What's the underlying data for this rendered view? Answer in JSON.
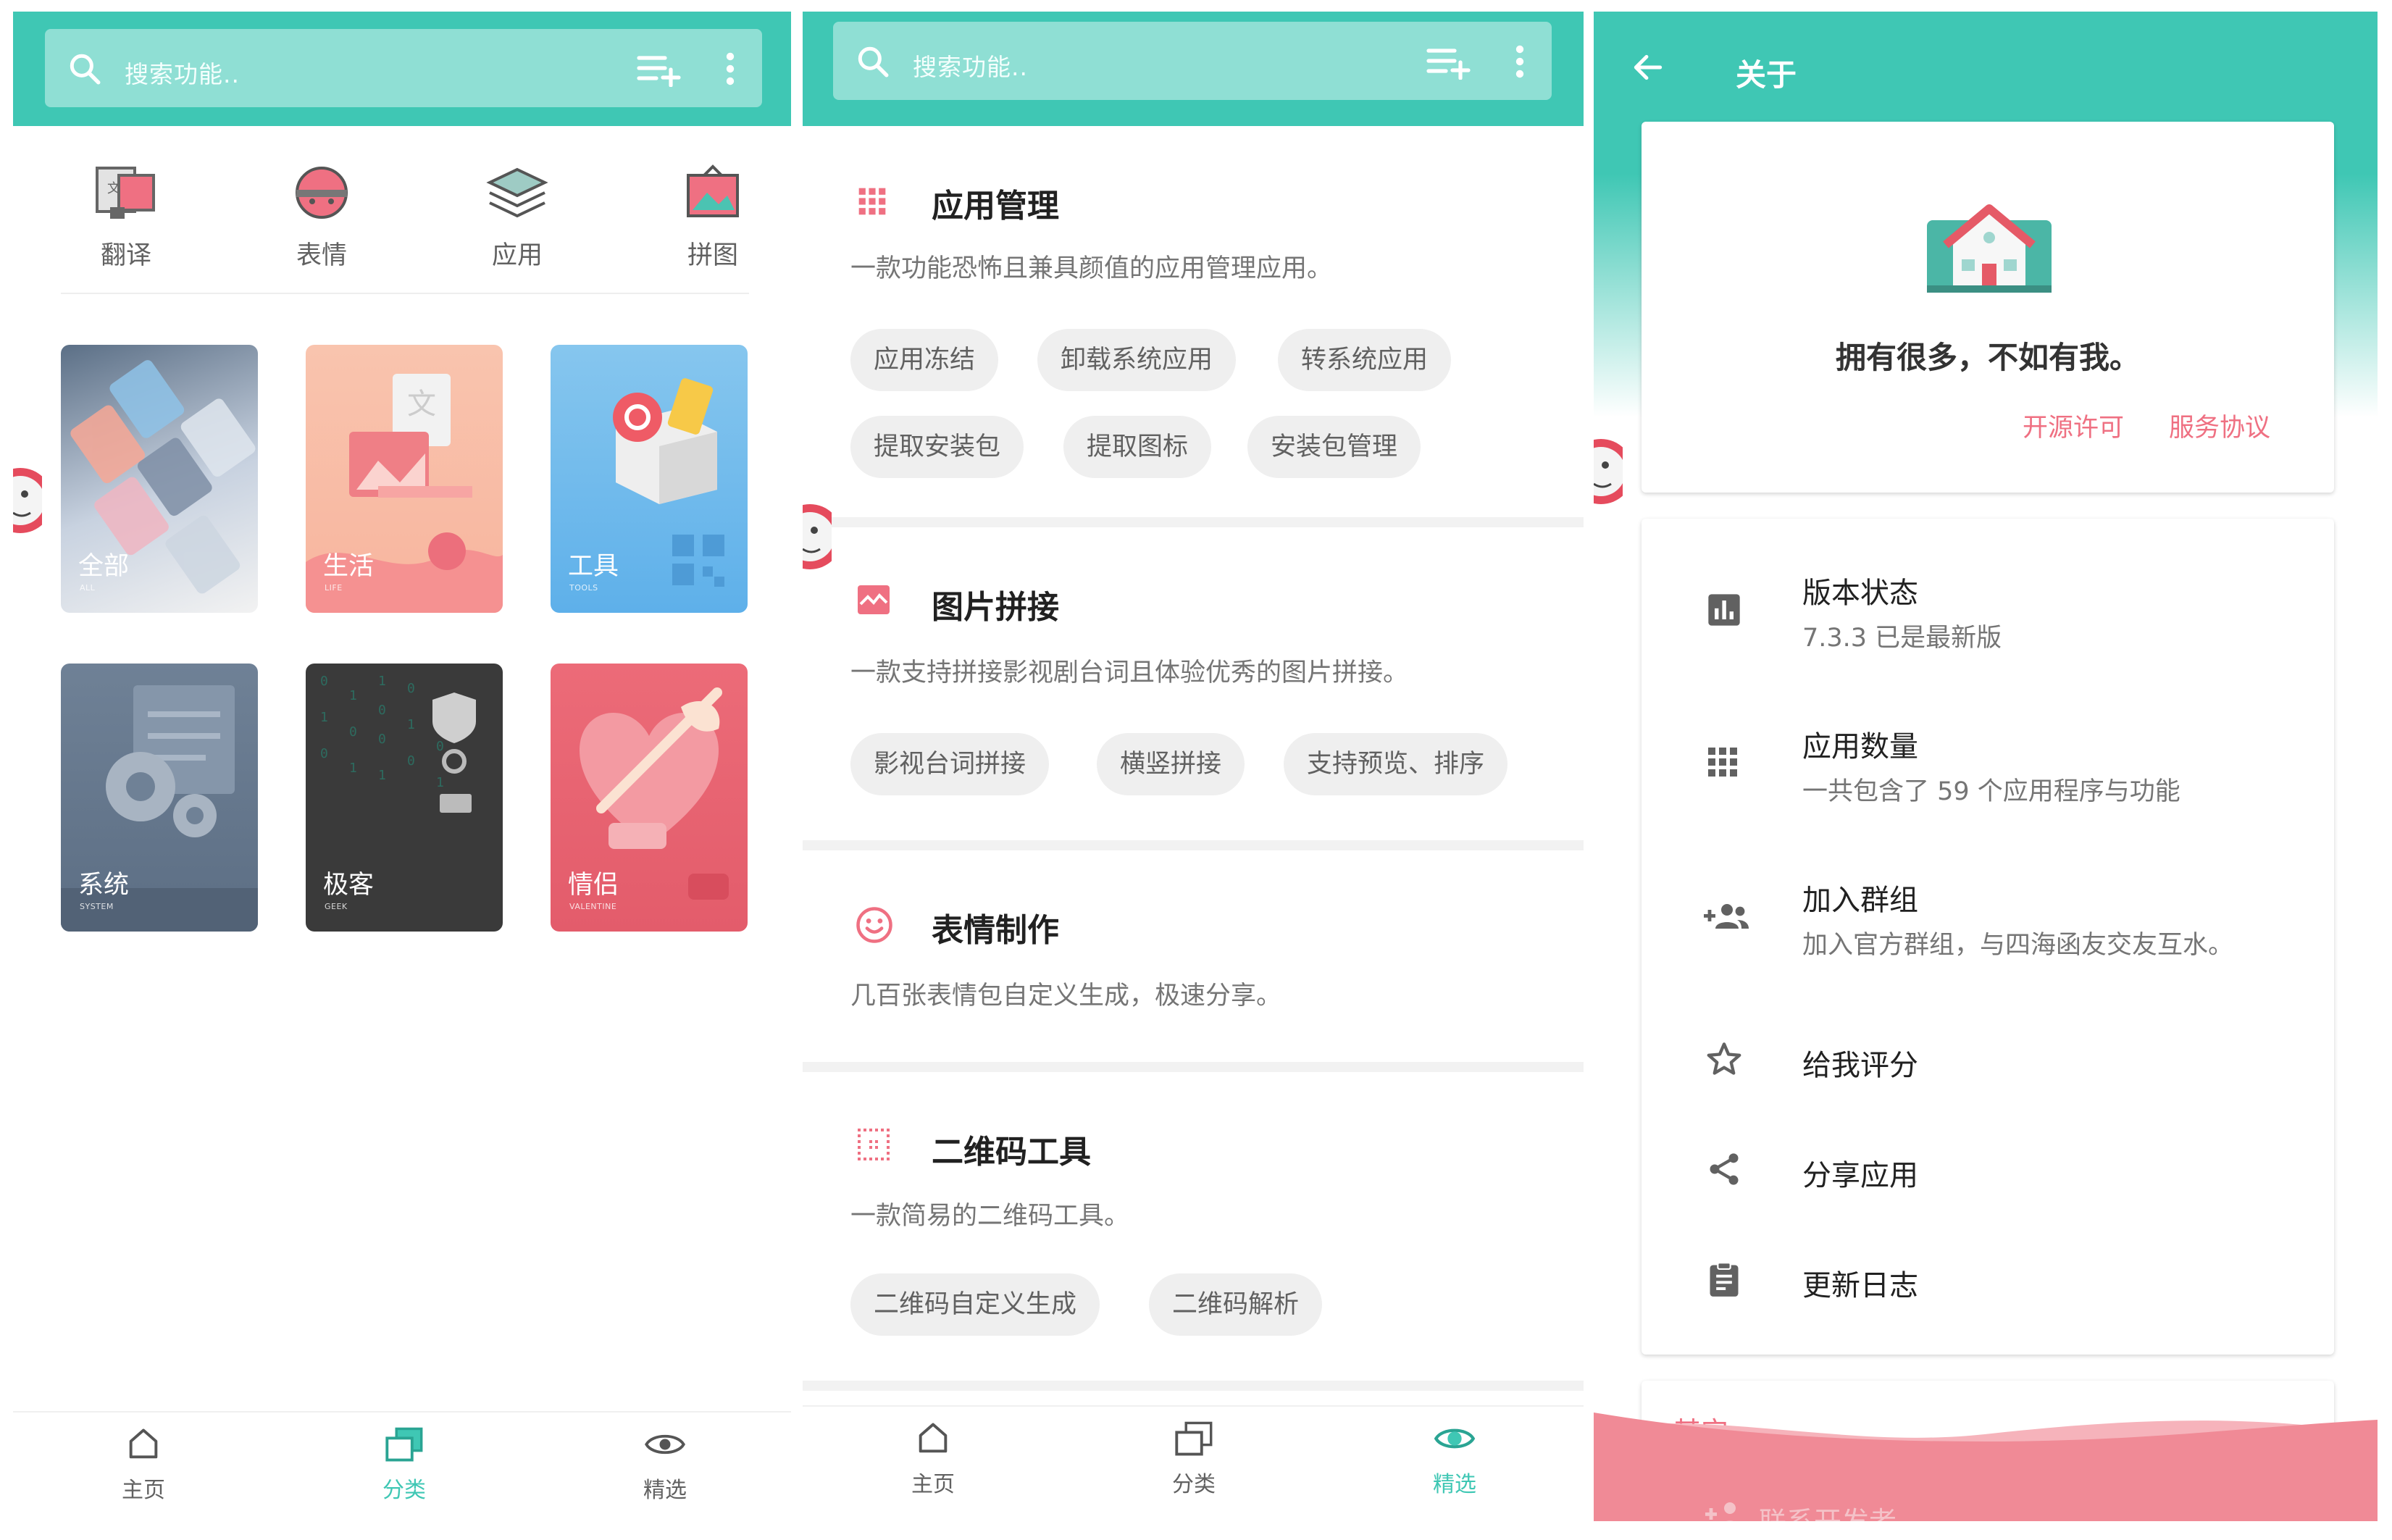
{
  "colors": {
    "accent": "#3fc7b4",
    "pink": "#ef7082",
    "wave": "#f08a96"
  },
  "screen1": {
    "search_placeholder": "搜索功能..",
    "quick_actions": [
      {
        "label": "翻译",
        "icon": "translate-icon"
      },
      {
        "label": "表情",
        "icon": "emoji-icon"
      },
      {
        "label": "应用",
        "icon": "layers-icon"
      },
      {
        "label": "拼图",
        "icon": "picture-icon"
      }
    ],
    "tiles": [
      {
        "title": "全部",
        "subtitle": "ALL"
      },
      {
        "title": "生活",
        "subtitle": "LIFE"
      },
      {
        "title": "工具",
        "subtitle": "TOOLS"
      },
      {
        "title": "系统",
        "subtitle": "SYSTEM"
      },
      {
        "title": "极客",
        "subtitle": "GEEK"
      },
      {
        "title": "情侣",
        "subtitle": "VALENTINE"
      }
    ],
    "nav": [
      {
        "label": "主页"
      },
      {
        "label": "分类"
      },
      {
        "label": "精选"
      }
    ],
    "nav_active": "分类"
  },
  "screen2": {
    "search_placeholder": "搜索功能..",
    "sections": [
      {
        "title": "应用管理",
        "desc": "一款功能恐怖且兼具颜值的应用管理应用。",
        "chips": [
          "应用冻结",
          "卸载系统应用",
          "转系统应用",
          "提取安装包",
          "提取图标",
          "安装包管理"
        ]
      },
      {
        "title": "图片拼接",
        "desc": "一款支持拼接影视剧台词且体验优秀的图片拼接。",
        "chips": [
          "影视台词拼接",
          "横竖拼接",
          "支持预览、排序"
        ]
      },
      {
        "title": "表情制作",
        "desc": "几百张表情包自定义生成，极速分享。",
        "chips": []
      },
      {
        "title": "二维码工具",
        "desc": "一款简易的二维码工具。",
        "chips": [
          "二维码自定义生成",
          "二维码解析"
        ]
      }
    ],
    "nav": [
      {
        "label": "主页"
      },
      {
        "label": "分类"
      },
      {
        "label": "精选"
      }
    ],
    "nav_active": "精选"
  },
  "screen3": {
    "title": "关于",
    "slogan": "拥有很多，不如有我。",
    "links": [
      "开源许可",
      "服务协议"
    ],
    "items": [
      {
        "title": "版本状态",
        "subtitle": "7.3.3  已是最新版",
        "icon": "bar-chart-icon"
      },
      {
        "title": "应用数量",
        "subtitle": "一共包含了 59 个应用程序与功能",
        "icon": "apps-grid-icon"
      },
      {
        "title": "加入群组",
        "subtitle": "加入官方群组，与四海函友交友互水。",
        "icon": "group-add-icon"
      },
      {
        "title": "给我评分",
        "subtitle": "",
        "icon": "star-icon"
      },
      {
        "title": "分享应用",
        "subtitle": "",
        "icon": "share-icon"
      },
      {
        "title": "更新日志",
        "subtitle": "",
        "icon": "clipboard-icon"
      }
    ],
    "other_header": "其它",
    "contact_label": "联系开发者"
  }
}
